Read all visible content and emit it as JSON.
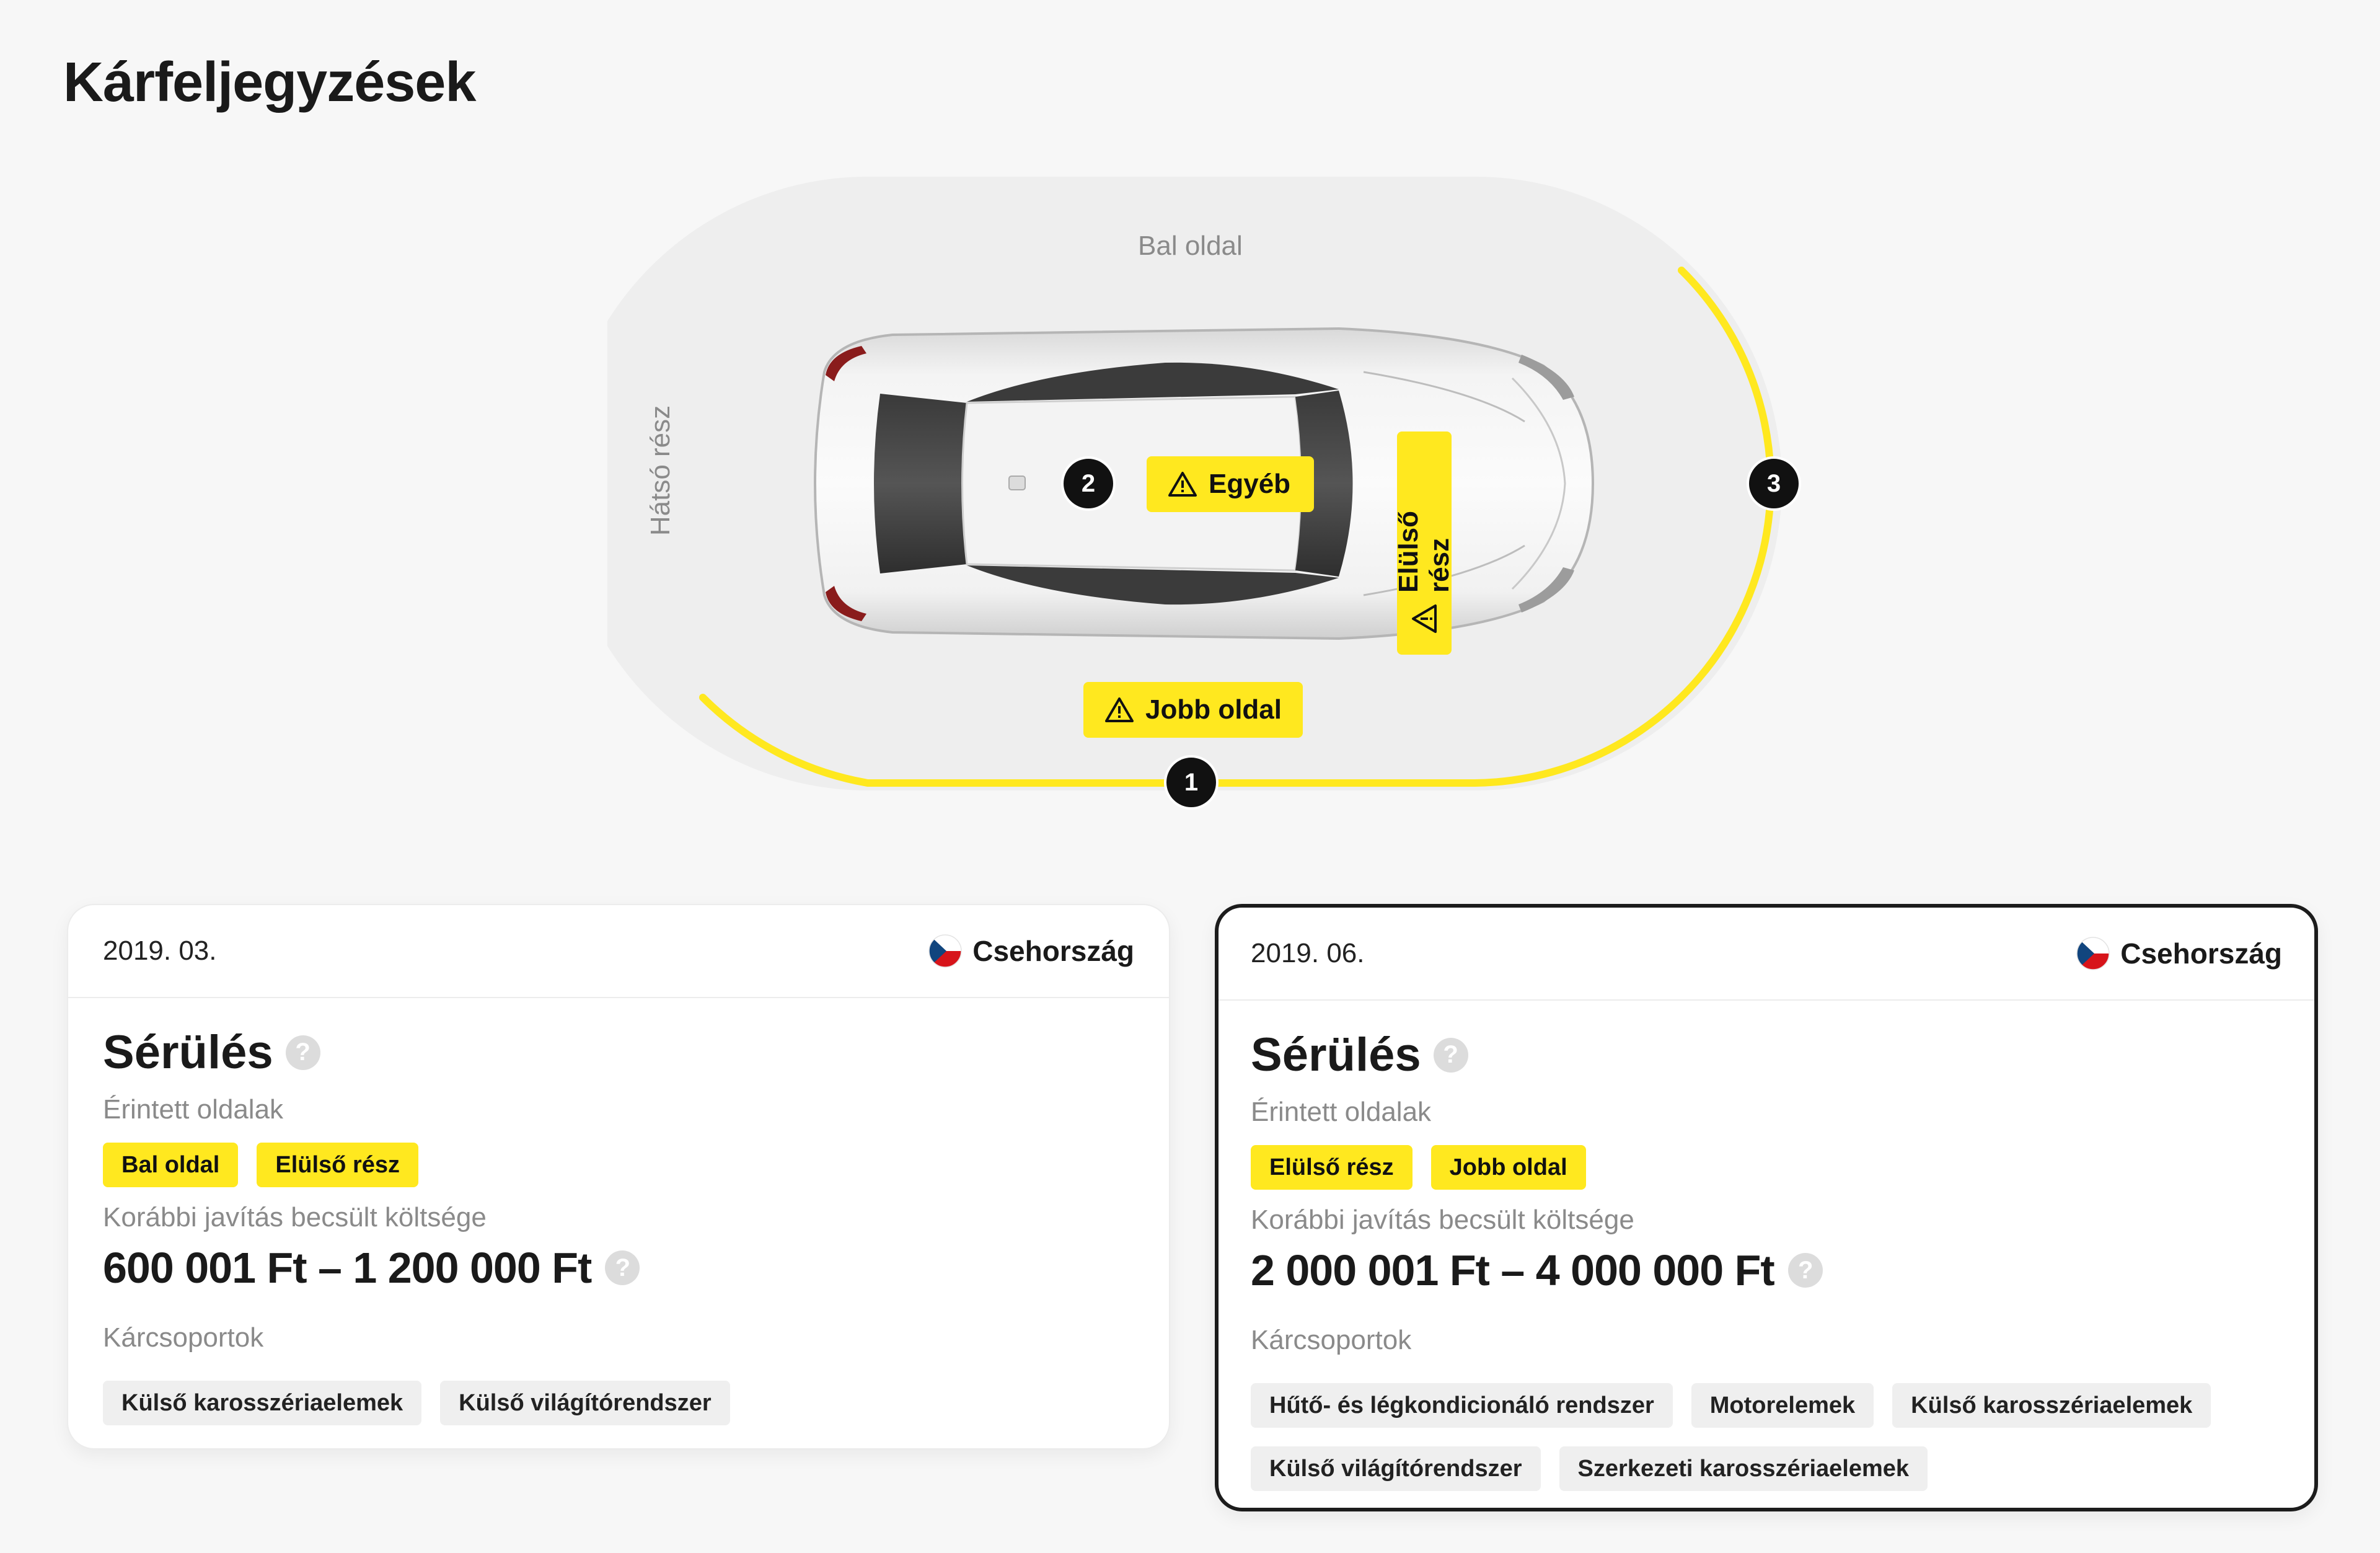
{
  "page": {
    "title": "Kárfeljegyzések"
  },
  "diagram": {
    "side_labels": {
      "left": "Bal oldal",
      "rear": "Hátsó rész"
    },
    "zones": {
      "other": "Egyéb",
      "right": "Jobb oldal",
      "front": "Elülső rész"
    },
    "markers": [
      "1",
      "2",
      "3"
    ],
    "highlight_color": "#ffe81f"
  },
  "cards": [
    {
      "date": "2019. 03.",
      "country": "Csehország",
      "title": "Sérülés",
      "affected_label": "Érintett oldalak",
      "affected": [
        "Bal oldal",
        "Elülső rész"
      ],
      "cost_label": "Korábbi javítás becsült költsége",
      "cost": "600 001 Ft – 1 200 000 Ft",
      "groups_label": "Kárcsoportok",
      "groups": [
        "Külső karosszériaelemek",
        "Külső világítórendszer"
      ],
      "selected": false
    },
    {
      "date": "2019. 06.",
      "country": "Csehország",
      "title": "Sérülés",
      "affected_label": "Érintett oldalak",
      "affected": [
        "Elülső rész",
        "Jobb oldal"
      ],
      "cost_label": "Korábbi javítás becsült költsége",
      "cost": "2 000 001 Ft – 4 000 000 Ft",
      "groups_label": "Kárcsoportok",
      "groups": [
        "Hűtő- és légkondicionáló rendszer",
        "Motorelemek",
        "Külső karosszériaelemek",
        "Külső világítórendszer",
        "Szerkezeti karosszériaelemek"
      ],
      "selected": true
    }
  ],
  "icons": {
    "warning": "warning-icon",
    "help": "help-icon",
    "flag": "czech-flag-icon"
  },
  "help_glyph": "?"
}
